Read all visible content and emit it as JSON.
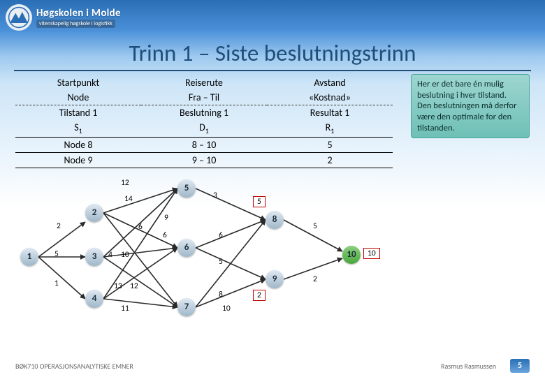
{
  "brand": {
    "name": "Høgskolen i Molde",
    "sub": "vitenskapelig høgskole i logistikk"
  },
  "title": "Trinn 1 – Siste beslutningstrinn",
  "table": {
    "r1": {
      "c1": "Startpunkt",
      "c2": "Reiserute",
      "c3": "Avstand"
    },
    "r2": {
      "c1": "Node",
      "c2": "Fra – Til",
      "c3": "«Kostnad»"
    },
    "r3": {
      "c1": "Tilstand 1",
      "c2": "Beslutning 1",
      "c3": "Resultat 1"
    },
    "r4": {
      "c1": "S",
      "c2": "D",
      "c3": "R",
      "sub": "1"
    },
    "r5": {
      "c1": "Node 8",
      "c2": "8 – 10",
      "c3": "5"
    },
    "r6": {
      "c1": "Node 9",
      "c2": "9 – 10",
      "c3": "2"
    }
  },
  "callout": "Her er det bare én mulig beslutning i hver tilstand.\nDen beslutningen må derfor være den optimale for den tilstanden.",
  "nodes": {
    "n1": "1",
    "n2": "2",
    "n3": "3",
    "n4": "4",
    "n5": "5",
    "n6": "6",
    "n7": "7",
    "n8": "8",
    "n9": "9",
    "n10": "10"
  },
  "weights": {
    "e12": "2",
    "e13": "5",
    "e14": "1",
    "e45": "12",
    "e46": "14",
    "e25": "9",
    "e26": "6",
    "e36": "4",
    "e27": "6",
    "e37": "10",
    "e47": "13",
    "e58": "3",
    "e68": "6",
    "e78": "12",
    "e69": "5",
    "e79": "8",
    "e711": "11",
    "e810": "5",
    "e910": "2",
    "e710": "10"
  },
  "results": {
    "r8": "5",
    "r9": "2",
    "r10": "10"
  },
  "footer": {
    "left": "BØK710 OPERASJONSANALYTISKE EMNER",
    "right": "Rasmus Rasmussen",
    "page": "5"
  }
}
